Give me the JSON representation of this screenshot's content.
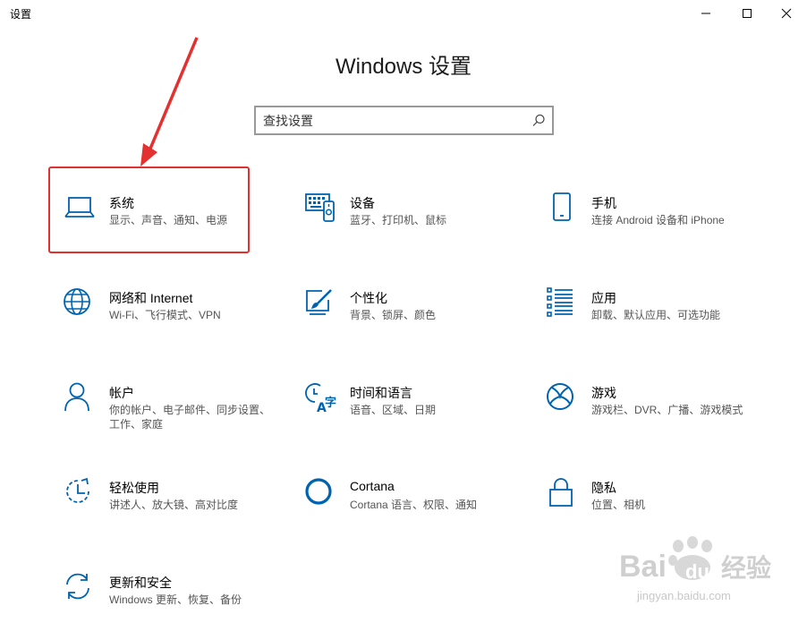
{
  "window": {
    "title": "设置"
  },
  "header": {
    "title": "Windows 设置"
  },
  "search": {
    "placeholder": "查找设置"
  },
  "tiles": [
    {
      "icon": "laptop-icon",
      "title": "系统",
      "desc": "显示、声音、通知、电源"
    },
    {
      "icon": "keyboard-devices-icon",
      "title": "设备",
      "desc": "蓝牙、打印机、鼠标"
    },
    {
      "icon": "phone-icon",
      "title": "手机",
      "desc": "连接 Android 设备和 iPhone"
    },
    {
      "icon": "globe-icon",
      "title": "网络和 Internet",
      "desc": "Wi-Fi、飞行模式、VPN"
    },
    {
      "icon": "paint-brush-icon",
      "title": "个性化",
      "desc": "背景、锁屏、颜色"
    },
    {
      "icon": "apps-list-icon",
      "title": "应用",
      "desc": "卸载、默认应用、可选功能"
    },
    {
      "icon": "person-icon",
      "title": "帐户",
      "desc": "你的帐户、电子邮件、同步设置、工作、家庭"
    },
    {
      "icon": "time-language-icon",
      "title": "时间和语言",
      "desc": "语音、区域、日期"
    },
    {
      "icon": "xbox-icon",
      "title": "游戏",
      "desc": "游戏栏、DVR、广播、游戏模式"
    },
    {
      "icon": "ease-of-access-icon",
      "title": "轻松使用",
      "desc": "讲述人、放大镜、高对比度"
    },
    {
      "icon": "cortana-icon",
      "title": "Cortana",
      "desc": "Cortana 语言、权限、通知"
    },
    {
      "icon": "lock-icon",
      "title": "隐私",
      "desc": "位置、相机"
    },
    {
      "icon": "update-sync-icon",
      "title": "更新和安全",
      "desc": "Windows 更新、恢复、备份"
    }
  ],
  "watermark": {
    "brand": "Bai",
    "brand2": "du",
    "suffix": "经验",
    "url": "jingyan.baidu.com"
  },
  "colors": {
    "accent": "#0063b1",
    "highlight": "#e03030"
  }
}
